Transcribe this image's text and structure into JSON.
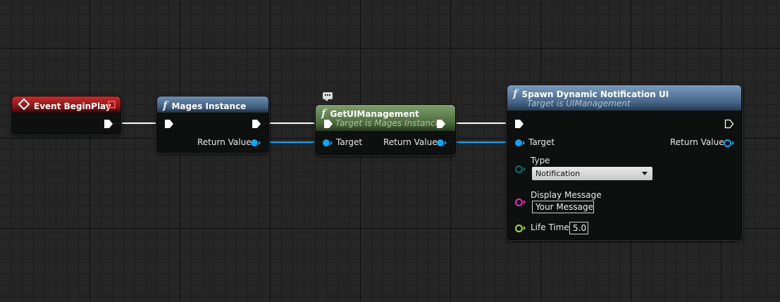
{
  "nodes": {
    "event_begin_play": {
      "title": "Event BeginPlay",
      "header_color": "#a72323"
    },
    "mages_instance": {
      "title": "Mages Instance",
      "return_label": "Return Value"
    },
    "get_ui_management": {
      "title": "GetUIManagement",
      "subtitle": "Target is Mages Instance",
      "target_label": "Target",
      "return_label": "Return Value"
    },
    "spawn_notification": {
      "title": "Spawn Dynamic Notification UI",
      "subtitle": "Target is UIManagement",
      "target_label": "Target",
      "return_label": "Return Value",
      "type_label": "Type",
      "type_value": "Notification",
      "display_message_label": "Display Message",
      "display_message_value": "Your Message",
      "life_time_label": "Life Time",
      "life_time_value": "5.0"
    }
  },
  "icons": {
    "function": "f",
    "event": "diamond"
  },
  "colors": {
    "object_pin": "#16a4ee",
    "byte_pin": "#0e6e6e",
    "string_pin": "#f028c8",
    "float_pin": "#a0e040",
    "exec_wire": "#ffffff"
  }
}
